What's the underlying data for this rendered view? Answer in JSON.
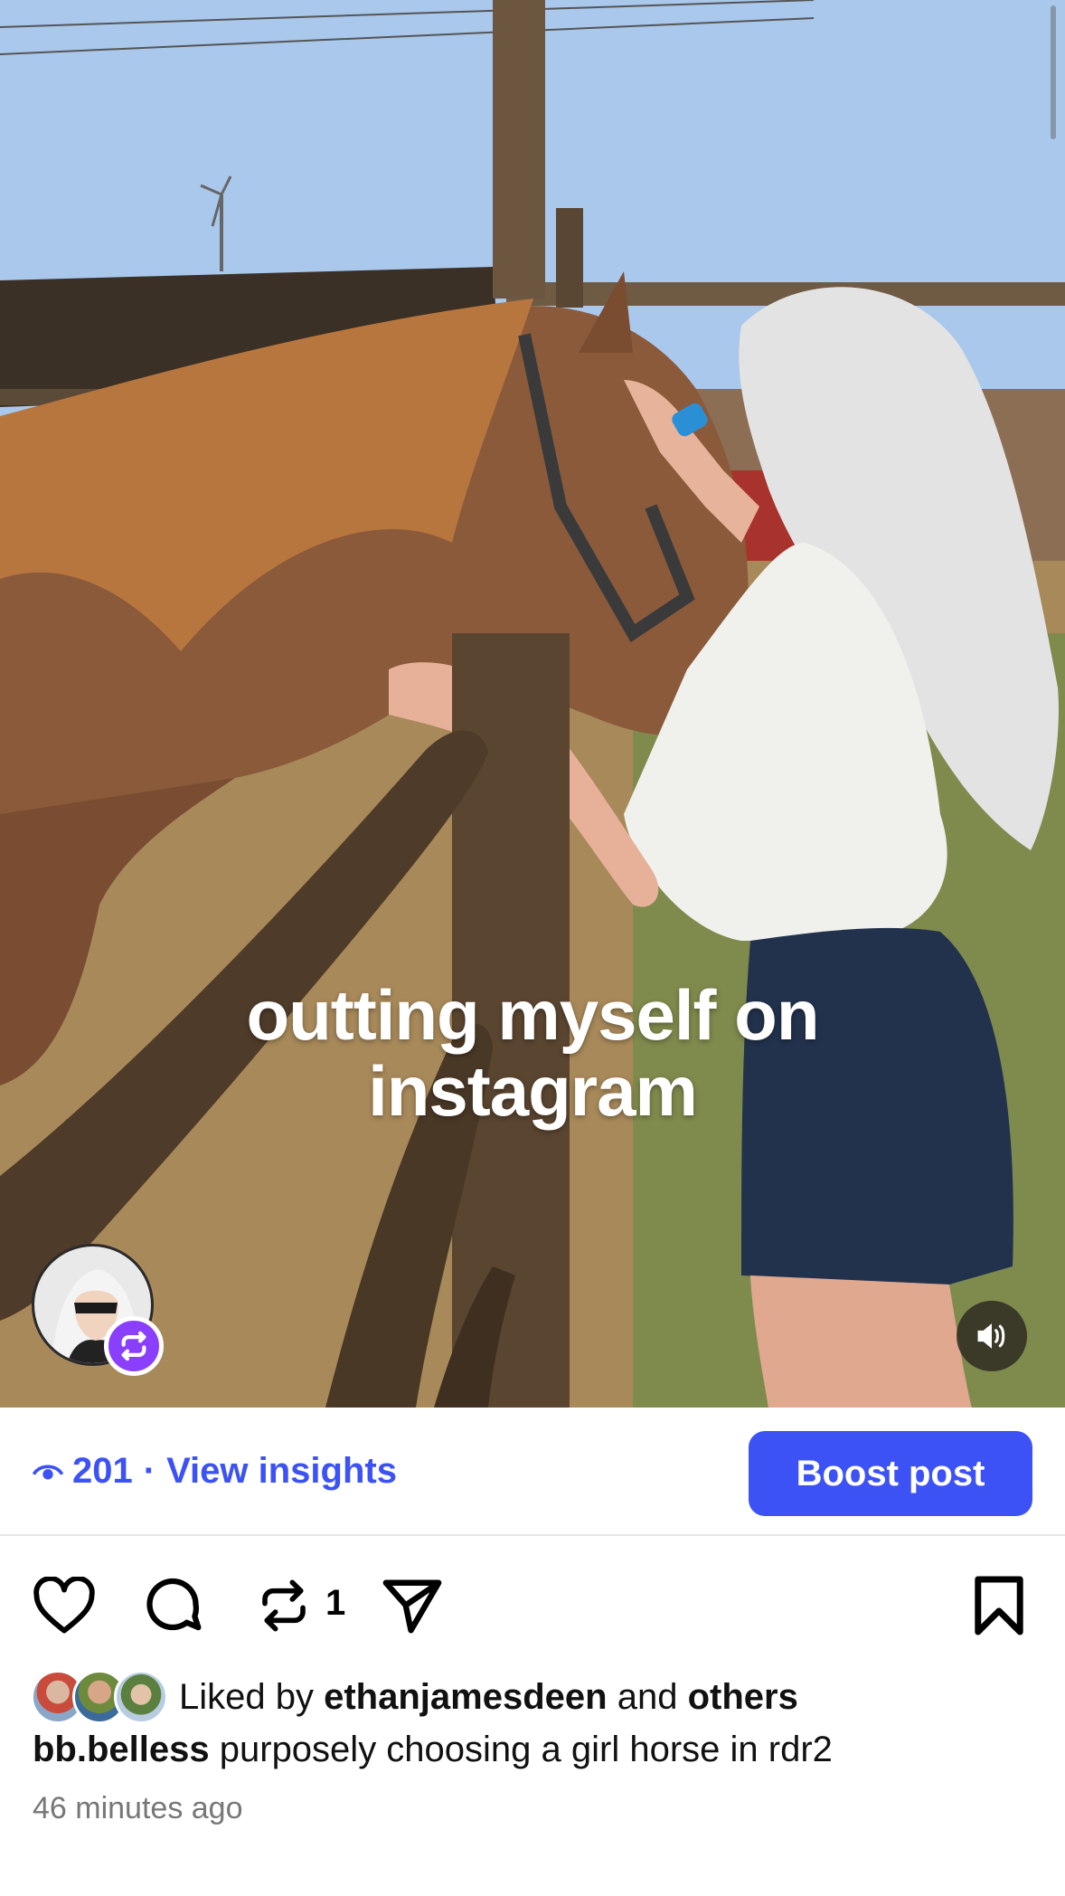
{
  "post": {
    "overlay_text": "outting myself on instagram",
    "views": "201",
    "separator": "·",
    "insights_label": "View insights",
    "boost_label": "Boost post",
    "repost_count": "1",
    "liked_by_prefix": "Liked by",
    "liked_by_user": "ethanjamesdeen",
    "liked_by_and": "and",
    "liked_by_others": "others",
    "author": "bb.belless",
    "caption": "purposely choosing a girl horse in rdr2",
    "timestamp": "46 minutes ago"
  },
  "colors": {
    "accent": "#3d52f5",
    "repost_badge": "#8a3ffc"
  },
  "icons": {
    "views": "eye-icon",
    "like": "heart-icon",
    "comment": "comment-bubble-icon",
    "repost": "repost-icon",
    "share": "send-icon",
    "save": "bookmark-icon",
    "sound": "speaker-icon",
    "repost_badge": "repost-badge-icon"
  }
}
